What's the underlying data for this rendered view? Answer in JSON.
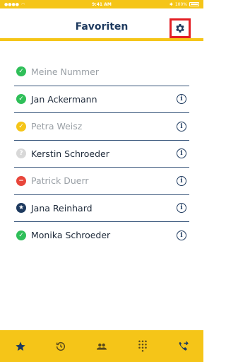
{
  "status_bar": {
    "time": "9:41 AM",
    "battery": "100%"
  },
  "header": {
    "title": "Favoriten"
  },
  "colors": {
    "accent": "#f5c518",
    "navy": "#1e3a5f",
    "green": "#2fbf59",
    "yellow": "#f5c518",
    "red": "#e8463b",
    "gray": "#d8d8d8",
    "highlight": "#e31e24"
  },
  "contacts": [
    {
      "name": "Meine Nummer",
      "status": "online",
      "muted": true,
      "info": false
    },
    {
      "name": "Jan Ackermann",
      "status": "online",
      "muted": false,
      "info": true
    },
    {
      "name": "Petra Weisz",
      "status": "away",
      "muted": true,
      "info": true
    },
    {
      "name": "Kerstin Schroeder",
      "status": "unknown",
      "muted": false,
      "info": true
    },
    {
      "name": "Patrick Duerr",
      "status": "busy",
      "muted": true,
      "info": true
    },
    {
      "name": "Jana Reinhard",
      "status": "favorite",
      "muted": false,
      "info": true
    },
    {
      "name": "Monika Schroeder",
      "status": "online",
      "muted": false,
      "info": true
    }
  ],
  "tabbar": {
    "tabs": [
      {
        "icon": "star-icon",
        "id": "favorites"
      },
      {
        "icon": "history-icon",
        "id": "history"
      },
      {
        "icon": "contacts-icon",
        "id": "contacts"
      },
      {
        "icon": "dialpad-icon",
        "id": "dialpad"
      },
      {
        "icon": "call-forward-icon",
        "id": "call-forward"
      }
    ]
  }
}
